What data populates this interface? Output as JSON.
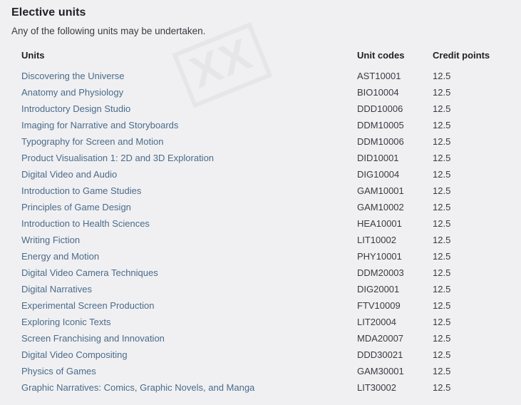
{
  "heading": {
    "title": "Elective units",
    "subtitle": "Any of the following units may be undertaken."
  },
  "watermark": {
    "text": "XX"
  },
  "table": {
    "columns": {
      "unit": "Units",
      "code": "Unit codes",
      "credit": "Credit points"
    },
    "rows": [
      {
        "unit": "Discovering the Universe",
        "code": "AST10001",
        "credit": "12.5"
      },
      {
        "unit": "Anatomy and Physiology",
        "code": "BIO10004",
        "credit": "12.5"
      },
      {
        "unit": "Introductory Design Studio",
        "code": "DDD10006",
        "credit": "12.5"
      },
      {
        "unit": "Imaging for Narrative and Storyboards",
        "code": "DDM10005",
        "credit": "12.5"
      },
      {
        "unit": "Typography for Screen and Motion",
        "code": "DDM10006",
        "credit": "12.5"
      },
      {
        "unit": "Product Visualisation 1: 2D and 3D Exploration",
        "code": "DID10001",
        "credit": "12.5"
      },
      {
        "unit": "Digital Video and Audio",
        "code": "DIG10004",
        "credit": "12.5"
      },
      {
        "unit": "Introduction to Game Studies",
        "code": "GAM10001",
        "credit": "12.5"
      },
      {
        "unit": "Principles of Game Design",
        "code": "GAM10002",
        "credit": "12.5"
      },
      {
        "unit": "Introduction to Health Sciences",
        "code": "HEA10001",
        "credit": "12.5"
      },
      {
        "unit": "Writing Fiction",
        "code": "LIT10002",
        "credit": "12.5"
      },
      {
        "unit": "Energy and Motion",
        "code": "PHY10001",
        "credit": "12.5"
      },
      {
        "unit": "Digital Video Camera Techniques",
        "code": "DDM20003",
        "credit": "12.5"
      },
      {
        "unit": "Digital Narratives",
        "code": "DIG20001",
        "credit": "12.5"
      },
      {
        "unit": "Experimental Screen Production",
        "code": "FTV10009",
        "credit": "12.5"
      },
      {
        "unit": "Exploring Iconic Texts",
        "code": "LIT20004",
        "credit": "12.5"
      },
      {
        "unit": "Screen Franchising and Innovation",
        "code": "MDA20007",
        "credit": "12.5"
      },
      {
        "unit": "Digital Video Compositing",
        "code": "DDD30021",
        "credit": "12.5"
      },
      {
        "unit": "Physics of Games",
        "code": "GAM30001",
        "credit": "12.5"
      },
      {
        "unit": "Graphic Narratives: Comics, Graphic Novels, and Manga",
        "code": "LIT30002",
        "credit": "12.5"
      }
    ]
  },
  "colors": {
    "background": "#f0f0f2",
    "link": "#4a6b8a",
    "heading": "#1f1f27",
    "body_text": "#3a3a44"
  }
}
